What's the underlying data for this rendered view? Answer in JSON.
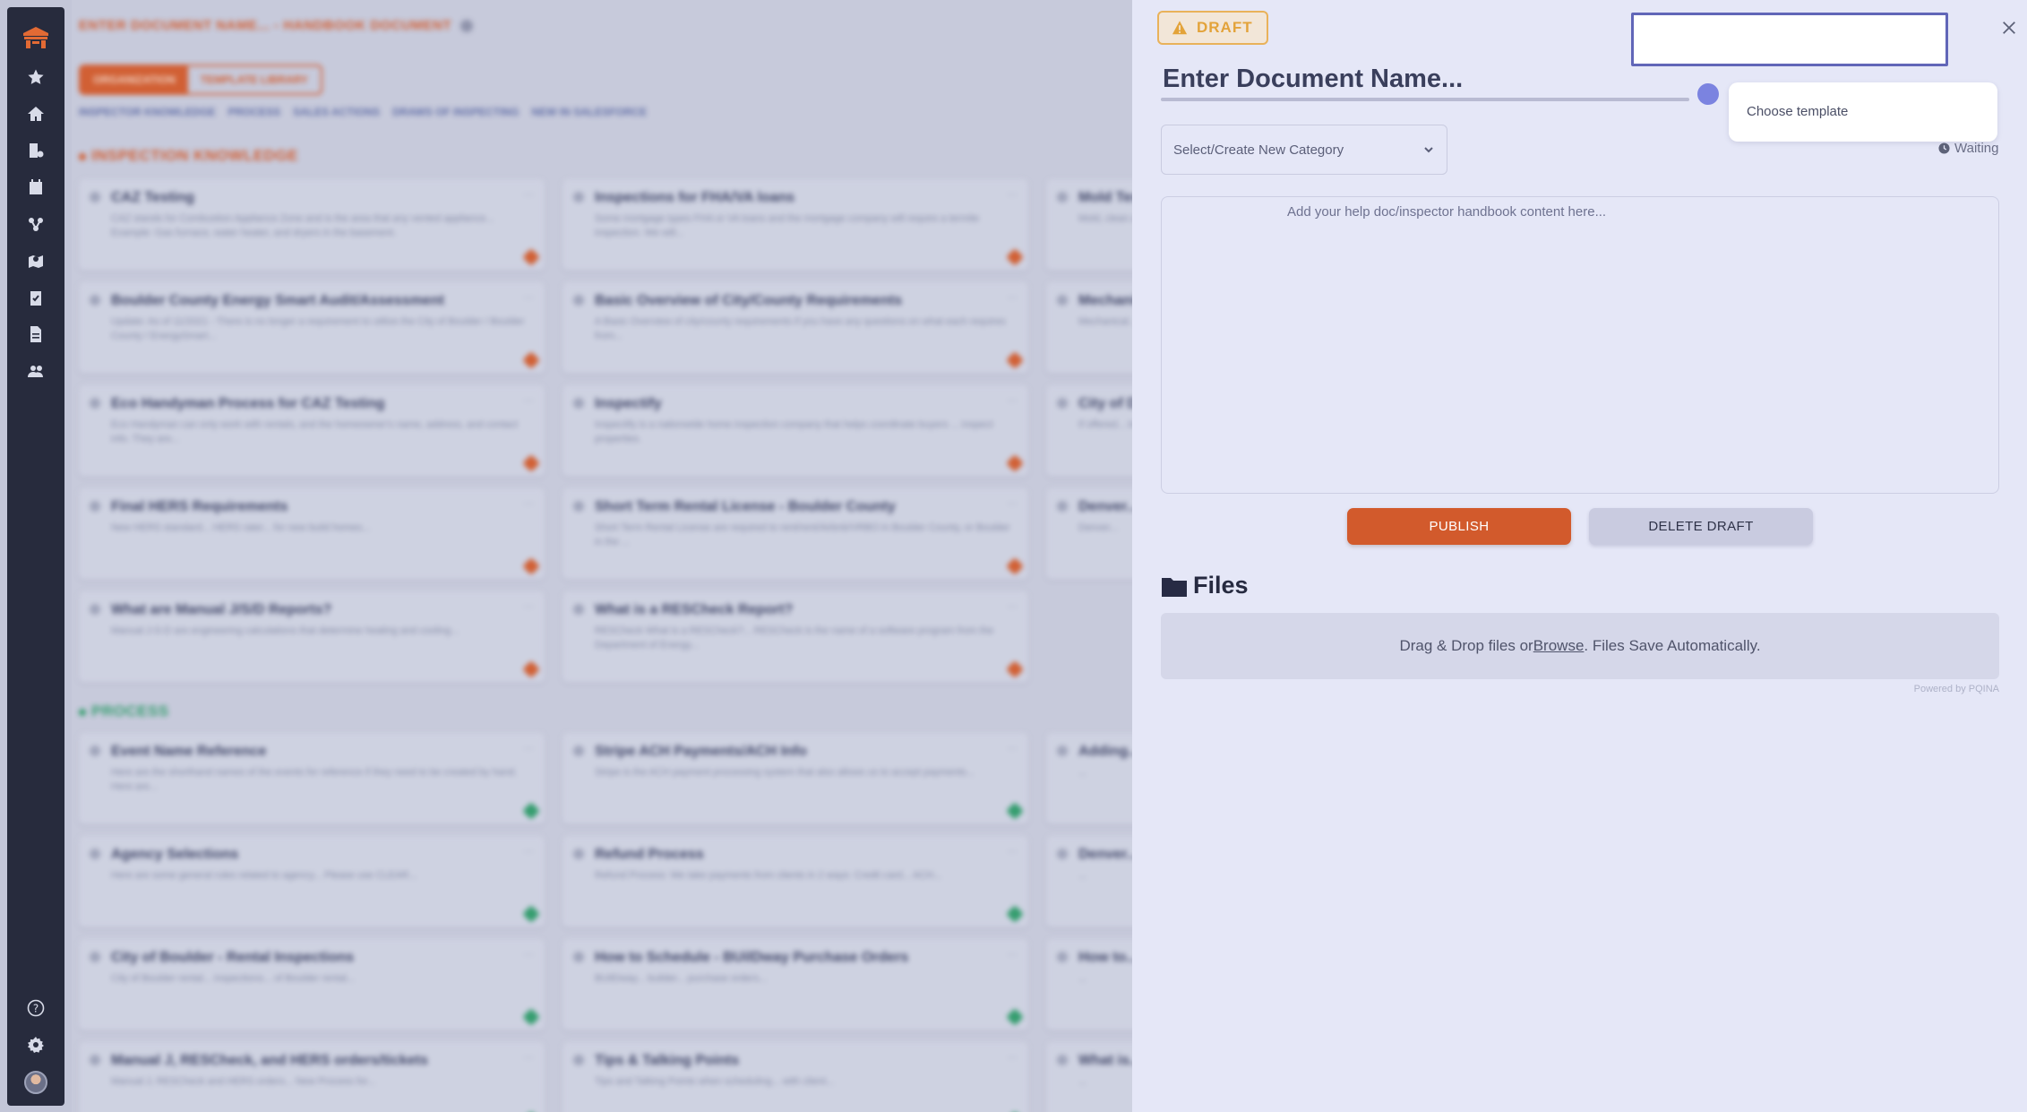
{
  "sidebar": {
    "icons": [
      "logo-icon",
      "star-icon",
      "home-icon",
      "building-icon",
      "calendar-icon",
      "network-icon",
      "map-icon",
      "clipboard-icon",
      "document-icon",
      "users-icon",
      "help-icon",
      "gear-icon",
      "avatar"
    ]
  },
  "background": {
    "title": "ENTER DOCUMENT NAME... - HANDBOOK DOCUMENT",
    "toggle": [
      "ORGANIZATION",
      "TEMPLATE LIBRARY"
    ],
    "subnav": [
      "INSPECTOR KNOWLEDGE",
      "PROCESS",
      "SALES ACTIONS",
      "DRAWS OF INSPECTING",
      "NEW IN SALESFORCE"
    ],
    "sections": [
      {
        "label": "INSPECTION KNOWLEDGE",
        "color": "#d25a2c"
      },
      {
        "label": "PROCESS",
        "color": "#2e9b6a"
      }
    ],
    "cards_inspection": [
      {
        "title": "CAZ Testing",
        "desc": "CAZ stands for Combustion Appliance Zone and is the area that any vented appliance... Example: Gas furnace, water heater, and dryers in the basement."
      },
      {
        "title": "Inspections for FHA/VA loans",
        "desc": "Some mortgage types FHA or VA loans and the mortgage company will require a termite inspection. We will..."
      },
      {
        "title": "Mold Testing",
        "desc": "Mold, clean and..."
      },
      {
        "title": "Boulder County Energy Smart Audit/Assessment",
        "desc": "Update: As of 11/2021 - There is no longer a requirement to utilize the City of Boulder / Boulder County / EnergySmart..."
      },
      {
        "title": "Basic Overview of City/County Requirements",
        "desc": "A Basic Overview of city/county requirements if you have any questions on what each requires from..."
      },
      {
        "title": "Mechanical",
        "desc": "Mechanical..."
      },
      {
        "title": "Eco Handyman Process for CAZ Testing",
        "desc": "Eco Handyman can only work with rentals, and the homeowner's name, address, and contact info. They are..."
      },
      {
        "title": "Inspectify",
        "desc": "Inspectify is a nationwide home inspection company that helps coordinate buyers ... inspect properties."
      },
      {
        "title": "City of Denver Inspections",
        "desc": "If offered... inspections."
      },
      {
        "title": "Final HERS Requirements",
        "desc": "New HERS standard... HERS rater... for new build homes..."
      },
      {
        "title": "Short Term Rental License - Boulder County",
        "desc": "Short Term Rental License are required to rent/rent/Airbnb/VRBO in Boulder County, or Boulder in the ..."
      },
      {
        "title": "Denver...",
        "desc": "Denver..."
      },
      {
        "title": "What are Manual J/S/D Reports?",
        "desc": "Manual J-S-D are engineering calculations that determine heating and cooling..."
      },
      {
        "title": "What is a RESCheck Report?",
        "desc": "RESCheck What is a RESCheck?... RESCheck is the name of a software program from the Department of Energy..."
      },
      {
        "title": "",
        "desc": ""
      }
    ],
    "cards_process": [
      {
        "title": "Event Name Reference",
        "desc": "Here are the shorthand names of the events for reference if they need to be created by hand. Here are..."
      },
      {
        "title": "Stripe ACH Payments/ACH Info",
        "desc": "Stripe is the ACH payment processing system that also allows us to accept payments..."
      },
      {
        "title": "Adding...",
        "desc": "..."
      },
      {
        "title": "Agency Selections",
        "desc": "Here are some general rules related to agency... Please use CLEAR..."
      },
      {
        "title": "Refund Process",
        "desc": "Refund Process: We take payments from clients in 2 ways: Credit card... ACH..."
      },
      {
        "title": "Denver...",
        "desc": "..."
      },
      {
        "title": "City of Boulder - Rental Inspections",
        "desc": "City of Boulder rental... inspections... of Boulder rental..."
      },
      {
        "title": "How to Schedule - BUilDway Purchase Orders",
        "desc": "BUilDway... builder... purchase orders..."
      },
      {
        "title": "How to...",
        "desc": "..."
      },
      {
        "title": "Manual J, RESCheck, and HERS orders/tickets",
        "desc": "Manual J, RESCheck and HERS orders... New Process for..."
      },
      {
        "title": "Tips & Talking Points",
        "desc": "Tips and Talking Points when scheduling... with client..."
      },
      {
        "title": "What is... Construction...",
        "desc": "..."
      }
    ]
  },
  "panel": {
    "draft_label": "DRAFT",
    "template_search_value": "",
    "template_option": "Choose template",
    "doc_name_placeholder": "Enter Document Name...",
    "category_placeholder": "Select/Create New Category",
    "status": "Waiting",
    "editor_placeholder": "Add your help doc/inspector handbook content here...",
    "publish_label": "PUBLISH",
    "delete_label": "DELETE DRAFT",
    "files_title": "Files",
    "dropzone_prefix": "Drag & Drop files or ",
    "dropzone_link": "Browse",
    "dropzone_suffix": ". Files Save Automatically.",
    "powered_by": "Powered by PQINA"
  },
  "colors": {
    "accent": "#d25a2c",
    "draft": "#e3a33a",
    "focus": "#6166b8",
    "rail": "#272b3d"
  }
}
